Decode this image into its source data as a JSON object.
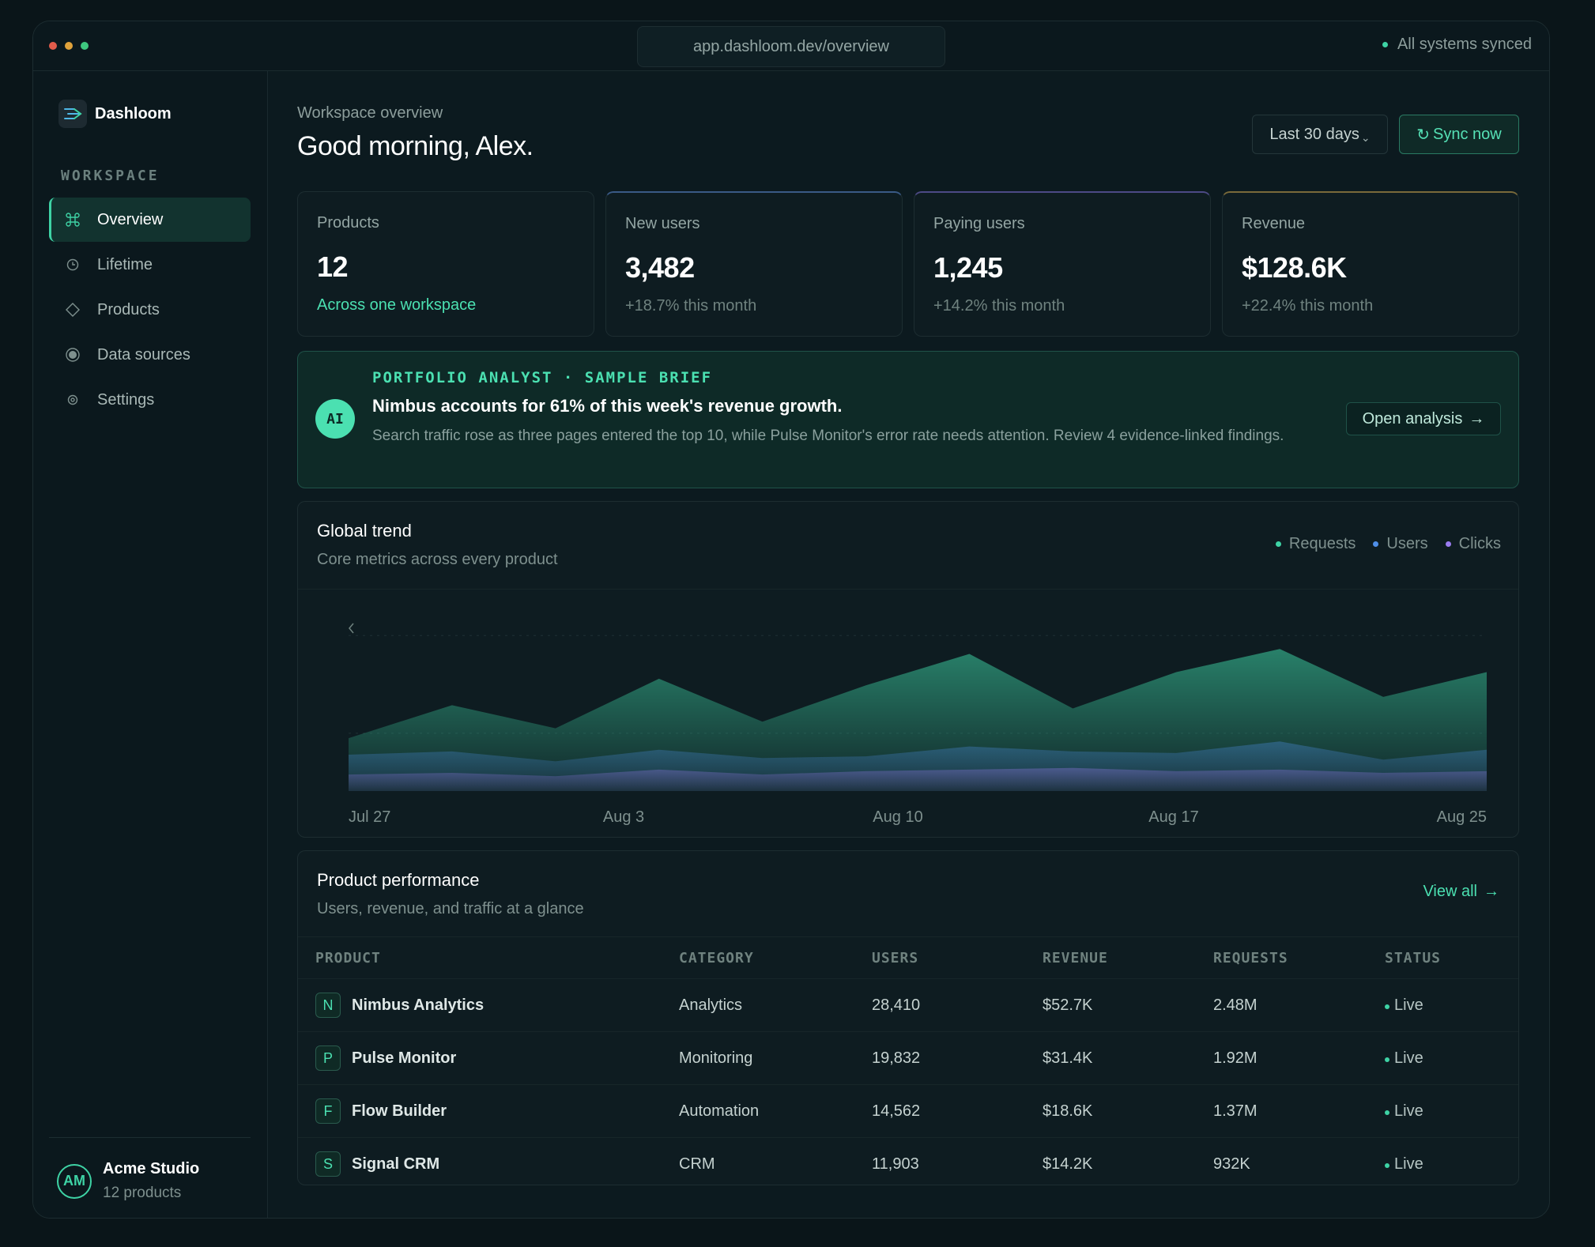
{
  "window": {
    "url": "app.dashloom.dev/overview",
    "sync_status": "All systems synced",
    "traffic_lights": [
      "#e25c4b",
      "#e0a23b",
      "#3ec77f"
    ]
  },
  "sidebar": {
    "brand": "Dashloom",
    "section_label": "WORKSPACE",
    "items": [
      {
        "label": "Overview",
        "icon": "command-icon",
        "active": true
      },
      {
        "label": "Lifetime",
        "icon": "clock-icon",
        "active": false
      },
      {
        "label": "Products",
        "icon": "diamond-icon",
        "active": false
      },
      {
        "label": "Data sources",
        "icon": "target-icon",
        "active": false
      },
      {
        "label": "Settings",
        "icon": "gear-icon",
        "active": false
      }
    ],
    "account": {
      "initials": "AM",
      "name": "Acme Studio",
      "sub": "12 products"
    }
  },
  "header": {
    "subtitle": "Workspace overview",
    "greeting": "Good morning, Alex.",
    "range_label": "Last 30 days",
    "sync_label": "Sync now"
  },
  "stats": [
    {
      "label": "Products",
      "value": "12",
      "note": "Across one workspace",
      "note_color": "#4be0b1",
      "accent": ""
    },
    {
      "label": "New users",
      "value": "3,482",
      "note": "+18.7% this month",
      "note_color": "#6f827f",
      "accent": "#3a5a86"
    },
    {
      "label": "Paying users",
      "value": "1,245",
      "note": "+14.2% this month",
      "note_color": "#6f827f",
      "accent": "#4d4a86"
    },
    {
      "label": "Revenue",
      "value": "$128.6K",
      "note": "+22.4% this month",
      "note_color": "#6f827f",
      "accent": "#7a6a3a"
    }
  ],
  "ai": {
    "badge": "AI",
    "eyebrow": "PORTFOLIO ANALYST · SAMPLE BRIEF",
    "headline": "Nimbus accounts for 61% of this week's revenue growth.",
    "body": "Search traffic rose as three pages entered the top 10, while Pulse Monitor's error rate needs attention. Review 4 evidence-linked findings.",
    "button": "Open analysis"
  },
  "trend": {
    "title": "Global trend",
    "subtitle": "Core metrics across every product",
    "legend": [
      {
        "label": "Requests",
        "color": "#3ed3a5"
      },
      {
        "label": "Users",
        "color": "#4f8fe8"
      },
      {
        "label": "Clicks",
        "color": "#9a7cf0"
      }
    ]
  },
  "chart_data": {
    "type": "area",
    "title": "Global trend",
    "x_tick_labels": [
      "Jul 27",
      "Aug 3",
      "Aug 10",
      "Aug 17",
      "Aug 25"
    ],
    "x_points": 12,
    "ylim": [
      0,
      100
    ],
    "grid": true,
    "legend_position": "top-right",
    "series": [
      {
        "name": "Requests",
        "color": "#3ed3a5",
        "values": [
          32,
          52,
          38,
          68,
          42,
          64,
          83,
          50,
          72,
          86,
          57,
          72
        ]
      },
      {
        "name": "Users",
        "color": "#4f8fe8",
        "values": [
          22,
          24,
          18,
          25,
          20,
          21,
          27,
          24,
          23,
          30,
          19,
          25
        ]
      },
      {
        "name": "Clicks",
        "color": "#9a7cf0",
        "values": [
          10,
          11,
          9,
          13,
          10,
          12,
          13,
          14,
          12,
          13,
          11,
          12
        ]
      }
    ]
  },
  "performance": {
    "title": "Product performance",
    "subtitle": "Users, revenue, and traffic at a glance",
    "view_all": "View all",
    "columns": [
      "PRODUCT",
      "CATEGORY",
      "USERS",
      "REVENUE",
      "REQUESTS",
      "STATUS"
    ],
    "rows": [
      {
        "initial": "N",
        "name": "Nimbus Analytics",
        "category": "Analytics",
        "users": "28,410",
        "revenue": "$52.7K",
        "requests": "2.48M",
        "status": "Live"
      },
      {
        "initial": "P",
        "name": "Pulse Monitor",
        "category": "Monitoring",
        "users": "19,832",
        "revenue": "$31.4K",
        "requests": "1.92M",
        "status": "Live"
      },
      {
        "initial": "F",
        "name": "Flow Builder",
        "category": "Automation",
        "users": "14,562",
        "revenue": "$18.6K",
        "requests": "1.37M",
        "status": "Live"
      },
      {
        "initial": "S",
        "name": "Signal CRM",
        "category": "CRM",
        "users": "11,903",
        "revenue": "$14.2K",
        "requests": "932K",
        "status": "Live"
      }
    ]
  }
}
